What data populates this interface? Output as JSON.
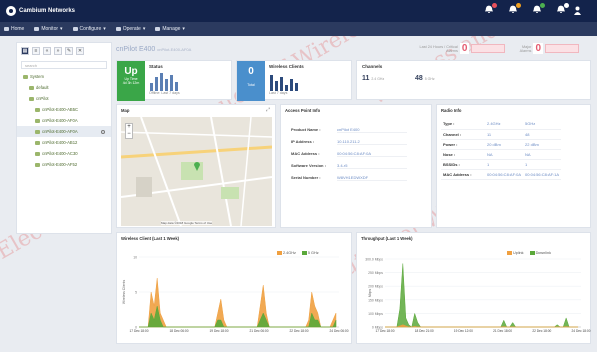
{
  "app": {
    "brand": "Cambium Networks"
  },
  "alerts": [
    {
      "icon": "bell-icon",
      "color": "#e8505b"
    },
    {
      "icon": "bell-icon",
      "color": "#f0a020"
    },
    {
      "icon": "bell-icon",
      "color": "#4caf50"
    },
    {
      "icon": "bell-icon",
      "color": "#ffffff"
    }
  ],
  "nav": [
    {
      "label": "Home",
      "icon": "home-icon"
    },
    {
      "label": "Monitor",
      "icon": "monitor-icon"
    },
    {
      "label": "Configure",
      "icon": "configure-icon"
    },
    {
      "label": "Operate",
      "icon": "operate-icon"
    },
    {
      "label": "Manage",
      "icon": "manage-icon"
    }
  ],
  "sidebar": {
    "search_placeholder": "search",
    "tree": [
      {
        "label": "System",
        "level": 0
      },
      {
        "label": "default",
        "level": 1
      },
      {
        "label": "cnPilot",
        "level": 1
      },
      {
        "label": "cnPilot-E400-AB5C",
        "level": 2
      },
      {
        "label": "cnPilot-E400-AF0A",
        "level": 2
      },
      {
        "label": "cnPilot-E400-AF0A",
        "level": 2,
        "selected": true
      },
      {
        "label": "cnPilot-E400-AB12",
        "level": 2
      },
      {
        "label": "cnPilot-E400-AC30",
        "level": 2
      },
      {
        "label": "cnPilot-E400-AF52",
        "level": 2
      }
    ]
  },
  "header": {
    "device": "cnPilot E400",
    "device_sub": "cnPilot-E400-AF0A",
    "stat1_label": "Last 24 Hours / Critical Alarms",
    "stat1_value": "0",
    "stat2_label": "Major Alarms",
    "stat2_value": "0"
  },
  "kpis": {
    "status": {
      "tile_value": "Up",
      "tile_sub1": "Up Time",
      "tile_sub2": "4d 3h 12m",
      "title": "Status",
      "sub": "Offline: Last 7 days",
      "color": "#3aa648"
    },
    "clients": {
      "tile_value": "0",
      "tile_sub1": "Total",
      "title": "Wireless Clients",
      "sub": "Last 7 days",
      "color": "#4a8fcc"
    },
    "channels": {
      "title": "Channels",
      "ch1": "11",
      "ch1_band": "2.4 GHz",
      "ch2": "48",
      "ch2_band": "5 GHz"
    }
  },
  "map": {
    "title": "Map",
    "attribution": "Map data ©2018 Google  Terms of Use",
    "zoom_in": "+",
    "zoom_out": "−"
  },
  "ap_info": {
    "title": "Access Point Info",
    "rows": [
      {
        "k": "Product Name :",
        "v": "cnPilot E400"
      },
      {
        "k": "IP Address :",
        "v": "10.110.211.2"
      },
      {
        "k": "MAC Address :",
        "v": "00:04:56:C8:AF:0A"
      },
      {
        "k": "Software Version :",
        "v": "3.4-r5"
      },
      {
        "k": "Serial Number :",
        "v": "W8VH1EDWXDF"
      }
    ]
  },
  "radio_info": {
    "title": "Radio Info",
    "cols": [
      "2.4GHz",
      "5GHz"
    ],
    "rows": [
      {
        "k": "Type :",
        "a": "2.4GHz",
        "b": "5GHz"
      },
      {
        "k": "Channel :",
        "a": "11",
        "b": "48"
      },
      {
        "k": "Power :",
        "a": "20 dBm",
        "b": "22 dBm"
      },
      {
        "k": "Nose :",
        "a": "NA",
        "b": "NA"
      },
      {
        "k": "BSSIDs :",
        "a": "1",
        "b": "1"
      },
      {
        "k": "MAC Address :",
        "a": "00:04:56:C8:AF:0A",
        "b": "00:04:56:C8:AF:1A"
      }
    ]
  },
  "wireless_chart": {
    "title": "Wireless Client (Last 1 Week)",
    "ylabel": "Wireless Clients",
    "legend": [
      {
        "name": "2.4GHz",
        "color": "#f0a040"
      },
      {
        "name": "5 GHz",
        "color": "#5aa83a"
      }
    ],
    "yticks": [
      "10",
      "5",
      "0"
    ],
    "xticks": [
      "17 Dec 18:00",
      "18 Dec 06:00",
      "19 Dec 18:00",
      "21 Dec 06:00",
      "22 Dec 18:00",
      "24 Dec 06:00"
    ],
    "series_a": [
      0,
      0,
      0,
      0,
      5,
      3,
      7,
      2,
      1,
      0,
      0,
      0,
      0,
      0,
      0,
      0,
      0,
      0,
      0,
      0,
      0,
      0,
      0,
      0,
      0,
      0,
      2,
      4,
      1,
      0,
      0,
      0,
      0,
      0,
      0,
      0,
      0,
      0,
      0,
      0,
      3,
      6,
      2,
      0,
      0,
      0,
      0,
      0,
      0,
      0,
      0,
      0,
      0,
      0,
      0,
      0,
      1,
      5,
      3,
      2,
      0,
      0,
      0,
      0,
      1,
      2
    ],
    "series_b": [
      0,
      0,
      0,
      0,
      2,
      1,
      3,
      1,
      0,
      0,
      0,
      0,
      0,
      0,
      0,
      0,
      0,
      0,
      0,
      0,
      0,
      0,
      0,
      0,
      0,
      0,
      1,
      1,
      0,
      0,
      0,
      0,
      0,
      0,
      0,
      0,
      0,
      0,
      0,
      0,
      1,
      2,
      1,
      0,
      0,
      0,
      0,
      0,
      0,
      0,
      0,
      0,
      0,
      0,
      0,
      0,
      0,
      2,
      1,
      1,
      0,
      0,
      0,
      0,
      0,
      1
    ],
    "ymax": 10
  },
  "throughput_chart": {
    "title": "Throughput (Last 1 Week)",
    "ylabel": "Mbps",
    "legend": [
      {
        "name": "Uplink",
        "color": "#f0a040"
      },
      {
        "name": "Downlink",
        "color": "#5aa83a"
      }
    ],
    "yticks": [
      "300.0 Mbps",
      "250 Mbps",
      "200 Mbps",
      "150 Mbps",
      "100 Mbps",
      "0 Mbps"
    ],
    "xticks": [
      "17 Dec 18:00",
      "18 Dec 21:00",
      "19 Dec 12:00",
      "21 Dec 18:00",
      "22 Dec 18:00",
      "24 Dec 18:00"
    ],
    "series_b": [
      0,
      0,
      0,
      0,
      0,
      80,
      280,
      40,
      10,
      0,
      60,
      20,
      0,
      0,
      0,
      0,
      0,
      0,
      0,
      0,
      0,
      0,
      0,
      0,
      0,
      0,
      0,
      0,
      0,
      0,
      0,
      0,
      0,
      0,
      0,
      0,
      0,
      0,
      0,
      0,
      30,
      0,
      0,
      20,
      0,
      0,
      0,
      0,
      0,
      0,
      0,
      0,
      0,
      0,
      0,
      0,
      0,
      0,
      10,
      0,
      0,
      40,
      0,
      0,
      0,
      0
    ],
    "series_a": [
      0,
      0,
      0,
      0,
      0,
      5,
      10,
      5,
      0,
      0,
      3,
      0,
      0,
      0,
      0,
      0,
      0,
      0,
      0,
      0,
      0,
      0,
      0,
      0,
      0,
      0,
      0,
      0,
      0,
      0,
      0,
      0,
      0,
      0,
      0,
      0,
      0,
      0,
      0,
      0,
      2,
      0,
      0,
      1,
      0,
      0,
      0,
      0,
      0,
      0,
      0,
      0,
      0,
      0,
      0,
      0,
      0,
      0,
      1,
      0,
      0,
      2,
      0,
      0,
      0,
      0
    ],
    "ymax": 300
  }
}
